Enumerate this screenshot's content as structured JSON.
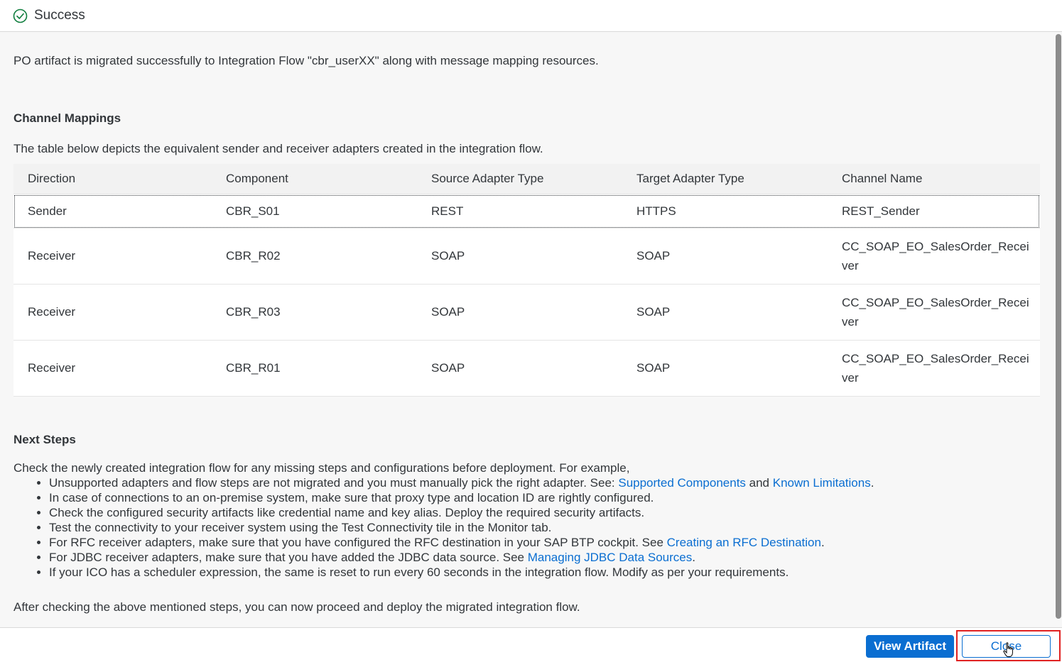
{
  "dialog": {
    "title": "Success",
    "status_icon": "success-check-circle-icon"
  },
  "intro_text": "PO artifact is migrated successfully to Integration Flow \"cbr_userXX\" along with message mapping resources.",
  "channel_mappings": {
    "title": "Channel Mappings",
    "description": "The table below depicts the equivalent sender and receiver adapters created in the integration flow.",
    "columns": [
      "Direction",
      "Component",
      "Source Adapter Type",
      "Target Adapter Type",
      "Channel Name"
    ],
    "rows": [
      [
        "Sender",
        "CBR_S01",
        "REST",
        "HTTPS",
        "REST_Sender"
      ],
      [
        "Receiver",
        "CBR_R02",
        "SOAP",
        "SOAP",
        "CC_SOAP_EO_SalesOrder_Recei ver"
      ],
      [
        "Receiver",
        "CBR_R03",
        "SOAP",
        "SOAP",
        "CC_SOAP_EO_SalesOrder_Recei ver"
      ],
      [
        "Receiver",
        "CBR_R01",
        "SOAP",
        "SOAP",
        "CC_SOAP_EO_SalesOrder_Recei ver"
      ]
    ]
  },
  "next_steps": {
    "title": "Next Steps",
    "intro": "Check the newly created integration flow for any missing steps and configurations before deployment. For example,",
    "items": [
      {
        "text": "Unsupported adapters and flow steps are not migrated and you must manually pick the right adapter. See: ",
        "link1": "Supported Components",
        "mid": " and ",
        "link2": "Known Limitations",
        "end": "."
      },
      {
        "text": "In case of connections to an on-premise system, make sure that proxy type and location ID are rightly configured."
      },
      {
        "text": "Check the configured security artifacts like credential name and key alias. Deploy the required security artifacts."
      },
      {
        "text": "Test the connectivity to your receiver system using the Test Connectivity tile in the Monitor tab."
      },
      {
        "text": "For RFC receiver adapters, make sure that you have configured the RFC destination in your SAP BTP cockpit. See ",
        "link1": "Creating an RFC Destination",
        "end": "."
      },
      {
        "text": "For JDBC receiver adapters, make sure that you have added the JDBC data source. See ",
        "link1": "Managing JDBC Data Sources",
        "end": "."
      },
      {
        "text": "If your ICO has a scheduler expression, the same is reset to run every 60 seconds in the integration flow. Modify as per your requirements."
      }
    ],
    "after": "After checking the above mentioned steps, you can now proceed and deploy the migrated integration flow."
  },
  "footer": {
    "view_artifact_label": "View Artifact",
    "close_label": "Close"
  },
  "colors": {
    "accent": "#0a6ed1",
    "success": "#107e3e",
    "highlight": "#e02020"
  }
}
